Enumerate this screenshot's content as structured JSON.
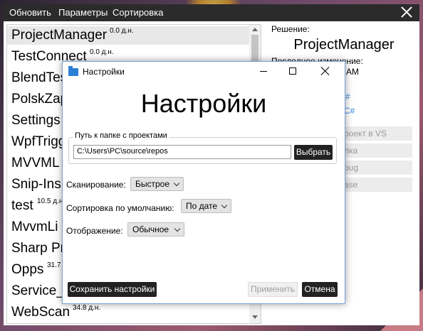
{
  "menu": {
    "refresh": "Обновить",
    "params": "Параметры",
    "sort": "Сортировка"
  },
  "projects": [
    {
      "name": "ProjectManager",
      "size": "0.0 д.н."
    },
    {
      "name": "TestConnect",
      "size": "0.0 д.н."
    },
    {
      "name": "BlendTes",
      "size": ""
    },
    {
      "name": "PolskZap",
      "size": ""
    },
    {
      "name": "Settings",
      "size": ""
    },
    {
      "name": "WpfTrigg",
      "size": ""
    },
    {
      "name": "MVVML",
      "size": ""
    },
    {
      "name": "Snip-Ins",
      "size": ""
    },
    {
      "name": "test",
      "size": "10.5 д.н."
    },
    {
      "name": "MvvmLi",
      "size": ""
    },
    {
      "name": "Sharp Pr",
      "size": ""
    },
    {
      "name": "Opps",
      "size": "31.7"
    },
    {
      "name": "Service_",
      "size": ""
    },
    {
      "name": "WebScan",
      "size": "34.8 д.н."
    }
  ],
  "details": {
    "solution_label": "Решение:",
    "solution_name": "ProjectManager",
    "last_change_label": "Последнее изменение:",
    "time_fragment": "AM",
    "lang_fragment1": "#",
    "lang_prefix": "r",
    "lang_fragment2": "C#",
    "btn_open_vs": "роект в VS",
    "btn_b": "лка",
    "btn_c": "bug",
    "btn_d": "ase"
  },
  "dialog": {
    "title": "Настройки",
    "heading": "Настройки",
    "folder_legend": "Путь к папке с проектами",
    "folder_path": "C:\\Users\\PC\\source\\repos",
    "browse_btn": "Выбрать",
    "scan_label": "Сканирование:",
    "scan_value": "Быстрое",
    "sort_label": "Сортировка по умолчанию:",
    "sort_value": "По дате",
    "display_label": "Отображение:",
    "display_value": "Обычное",
    "save_btn": "Сохранить настройки",
    "apply_btn": "Применить",
    "cancel_btn": "Отмена"
  }
}
